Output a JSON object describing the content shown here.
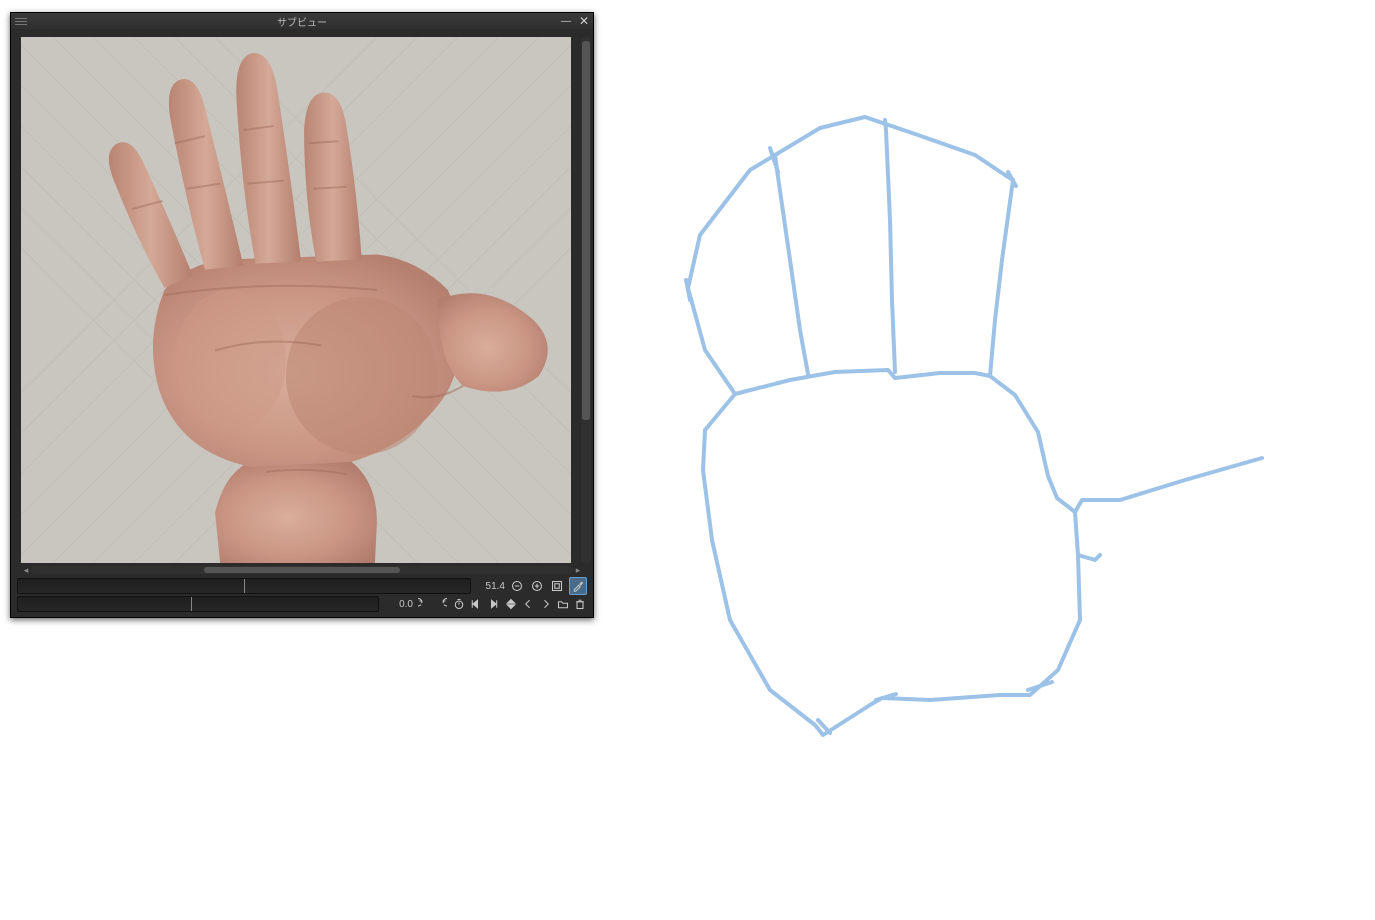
{
  "subview": {
    "title": "サブビュー",
    "zoom": {
      "value": "51.4",
      "slider_pos_pct": 50
    },
    "rotation": {
      "value": "0.0",
      "slider_pos_pct": 48
    },
    "icons": {
      "menu": "menu-icon",
      "minimize": "minimize-icon",
      "close": "close-icon",
      "zoom_out": "zoom-out-icon",
      "zoom_in": "zoom-in-icon",
      "fit": "fit-screen-icon",
      "eyedropper": "eyedropper-icon",
      "undo": "undo-icon",
      "redo": "redo-icon",
      "timer": "timer-icon",
      "step_back": "step-back-icon",
      "step_fwd": "step-forward-icon",
      "flip": "flip-icon",
      "prev": "prev-icon",
      "next": "next-icon",
      "open": "open-folder-icon",
      "trash": "trash-icon"
    },
    "reference_image": {
      "description": "open-left-hand-palm-facing-camera",
      "background": "white-textured-wallpaper"
    }
  },
  "sketch": {
    "stroke_color": "#9cc2e8",
    "subject": "hand-block-in"
  }
}
